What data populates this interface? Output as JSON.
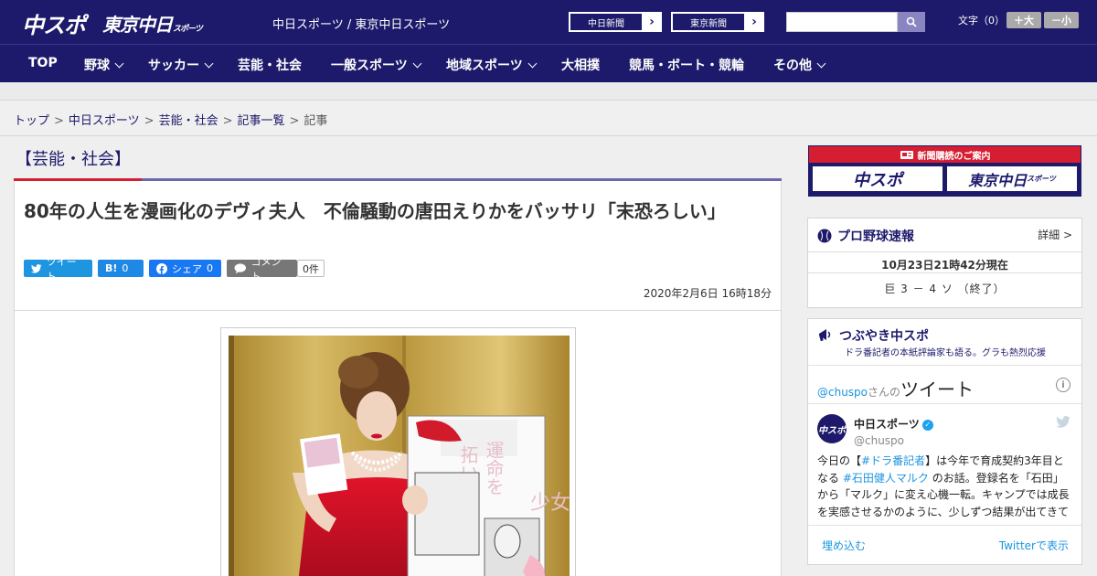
{
  "header": {
    "logo_chuspo": "中スポ",
    "logo_tokyo": "東京中日",
    "logo_tokyo_sub": "スポーツ",
    "site_title": "中日スポーツ / 東京中日スポーツ",
    "ext_links": [
      "中日新聞",
      "東京新聞"
    ],
    "search_placeholder": "",
    "font_label": "文字（0）",
    "font_plus": "＋大",
    "font_minus": "－小"
  },
  "nav": {
    "items": [
      {
        "label": "TOP",
        "chevron": false
      },
      {
        "label": "野球",
        "chevron": true
      },
      {
        "label": "サッカー",
        "chevron": true
      },
      {
        "label": "芸能・社会",
        "chevron": false
      },
      {
        "label": "一般スポーツ",
        "chevron": true
      },
      {
        "label": "地域スポーツ",
        "chevron": true
      },
      {
        "label": "大相撲",
        "chevron": false
      },
      {
        "label": "競馬・ボート・競輪",
        "chevron": false
      },
      {
        "label": "その他",
        "chevron": true
      }
    ]
  },
  "breadcrumb": {
    "items": [
      "トップ",
      "中日スポーツ",
      "芸能・社会",
      "記事一覧"
    ],
    "current": "記事",
    "separator": ">"
  },
  "article": {
    "category": "【芸能・社会】",
    "headline": "80年の人生を漫画化のデヴィ夫人　不倫騒動の唐田えりかをバッサリ「末恐ろしい」",
    "social": {
      "tweet": "ツイート",
      "hatena": "B!",
      "hatena_count": "0",
      "facebook": "シェア",
      "facebook_count": "0",
      "comment": "コメント",
      "comment_count": "0件"
    },
    "date": "2020年2月6日 16時18分",
    "manga_text_1": "運命を",
    "manga_text_2": "拓いた",
    "manga_text_3": "少女"
  },
  "sidebar": {
    "subscribe_title": "新聞購読のご案内",
    "subscribe_left": "中スポ",
    "subscribe_right": "東京中日",
    "subscribe_right_sub": "スポーツ",
    "baseball": {
      "title": "プロ野球速報",
      "detail": "詳細 >",
      "timestamp": "10月23日21時42分現在",
      "score": "巨 3 － 4 ソ （終了）"
    },
    "tweets": {
      "title": "つぶやき中スポ",
      "subtitle": "ドラ番記者の本紙評論家も語る。グラも熱烈応援",
      "handle": "@chuspo",
      "handle_suffix": "さんの",
      "header_big": "ツイート",
      "user_name": "中日スポーツ",
      "user_screen": "@chuspo",
      "avatar_text": "中スポ",
      "text_1": "今日の【",
      "link_1": "#ドラ番記者",
      "text_2": "】は今年で育成契約3年目となる ",
      "link_2": "#石田健人マルク",
      "text_3": " のお話。登録名を「石田」から「マルク」に変え心機一転。キャンプでは成長を実感させるかのように、少しずつ結果が出てきている",
      "embed": "埋め込む",
      "view_on": "Twitterで表示"
    }
  },
  "colors": {
    "brand_navy": "#1d1a6b",
    "accent_red": "#d61e32",
    "accent_purple": "#6b67a8",
    "twitter_blue": "#1b95e0"
  }
}
